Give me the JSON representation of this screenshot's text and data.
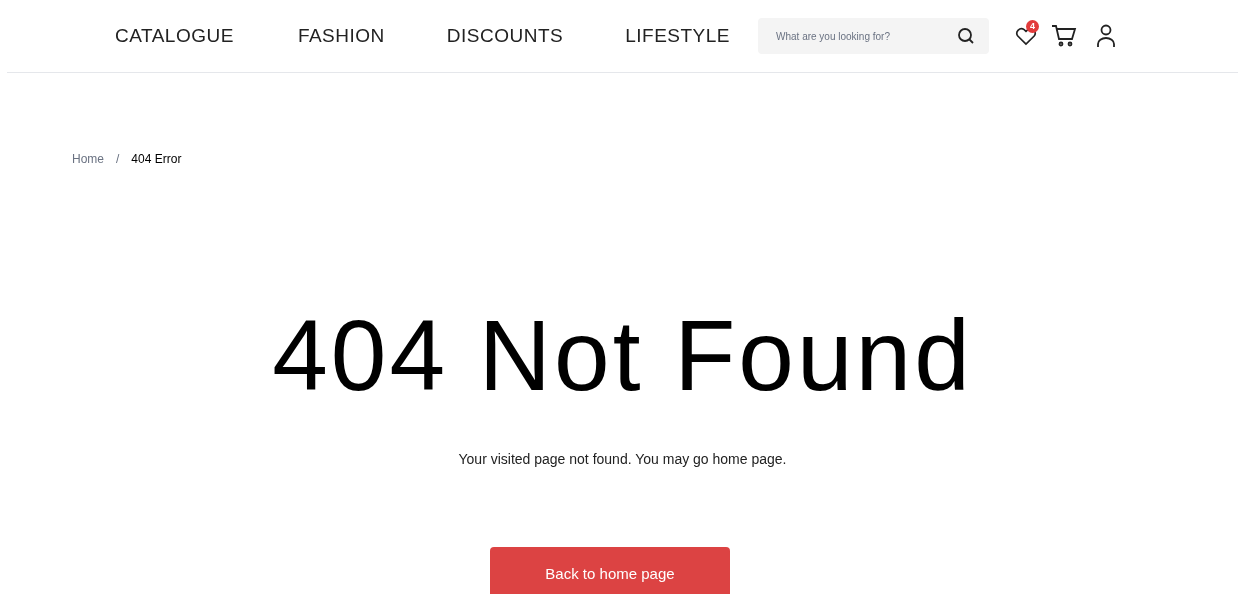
{
  "nav": {
    "items": [
      "CATALOGUE",
      "FASHION",
      "DISCOUNTS",
      "LIFESTYLE"
    ],
    "search": {
      "placeholder": "What are you looking for?"
    },
    "wishlist_badge": "4"
  },
  "breadcrumb": [
    "Home",
    "/",
    "404 Error"
  ],
  "heading": "404 Not Found",
  "message": "Your visited page not found. You may go home page.",
  "button": "Back to home page"
}
